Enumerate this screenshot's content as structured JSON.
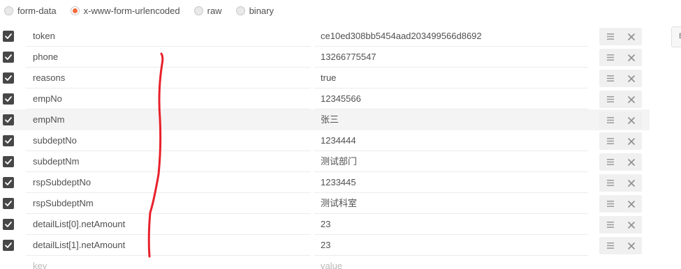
{
  "body_types": [
    {
      "label": "form-data",
      "selected": false
    },
    {
      "label": "x-www-form-urlencoded",
      "selected": true
    },
    {
      "label": "raw",
      "selected": false
    },
    {
      "label": "binary",
      "selected": false
    }
  ],
  "side_panel": {
    "label": "B"
  },
  "rows": [
    {
      "key": "token",
      "value": "ce10ed308bb5454aad203499566d8692",
      "checked": true
    },
    {
      "key": "phone",
      "value": "13266775547",
      "checked": true
    },
    {
      "key": "reasons",
      "value": "true",
      "checked": true
    },
    {
      "key": "empNo",
      "value": "12345566",
      "checked": true
    },
    {
      "key": "empNm",
      "value": "张三",
      "checked": true
    },
    {
      "key": "subdeptNo",
      "value": "1234444",
      "checked": true
    },
    {
      "key": "subdeptNm",
      "value": "测试部门",
      "checked": true
    },
    {
      "key": "rspSubdeptNo",
      "value": "1233445",
      "checked": true
    },
    {
      "key": "rspSubdeptNm",
      "value": "测试科室",
      "checked": true
    },
    {
      "key": "detailList[0].netAmount",
      "value": "23",
      "checked": true
    },
    {
      "key": "detailList[1].netAmount",
      "value": "23",
      "checked": true
    }
  ],
  "new_row": {
    "key_placeholder": "key",
    "value_placeholder": "value"
  },
  "colors": {
    "accent_radio": "#f26b3a",
    "checkbox": "#474747",
    "annotation_stroke": "#e8202a"
  },
  "icons": {
    "drag": "hamburger-icon",
    "delete": "close-icon",
    "checkbox": "check-icon"
  }
}
